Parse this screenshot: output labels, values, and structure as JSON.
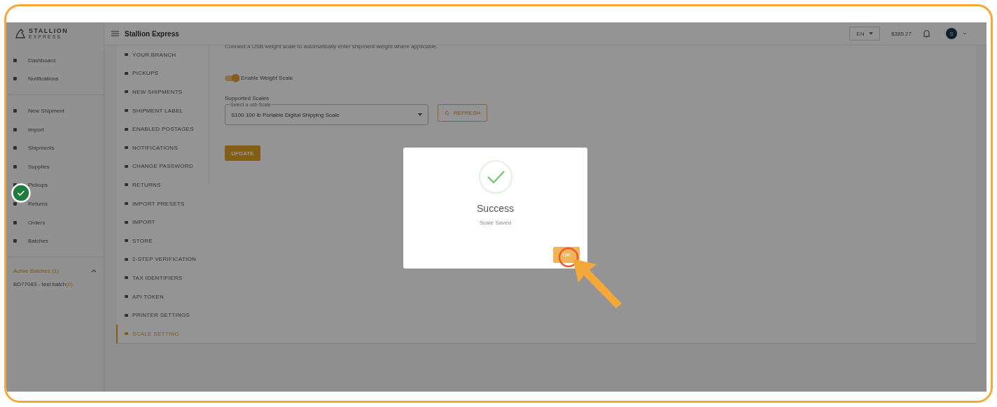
{
  "sidebar": {
    "logo": {
      "name": "STALLION",
      "sub": "EXPRESS"
    },
    "groups": [
      [
        {
          "label": "Dashboard"
        },
        {
          "label": "Notifications"
        }
      ],
      [
        {
          "label": "New Shipment"
        },
        {
          "label": "Import"
        },
        {
          "label": "Shipments"
        },
        {
          "label": "Supplies"
        },
        {
          "label": "Pickups"
        },
        {
          "label": "Returns"
        },
        {
          "label": "Orders"
        },
        {
          "label": "Batches"
        }
      ]
    ],
    "active_batches": {
      "title": "Active Batches (1)",
      "expanded": true,
      "items": [
        {
          "label": "BD77083 - test batch",
          "count": "(0)"
        }
      ]
    }
  },
  "topbar": {
    "title": "Stallion Express",
    "language": "EN",
    "balance": "$385.27",
    "avatar": "S"
  },
  "settings_menu": [
    {
      "label": "YOUR BRANCH",
      "selected": false
    },
    {
      "label": "PICKUPS",
      "selected": false
    },
    {
      "label": "NEW SHIPMENTS",
      "selected": false
    },
    {
      "label": "SHIPMENT LABEL",
      "selected": false
    },
    {
      "label": "ENABLED POSTAGES",
      "selected": false
    },
    {
      "label": "NOTIFICATIONS",
      "selected": false
    },
    {
      "label": "CHANGE PASSWORD",
      "selected": false
    },
    {
      "label": "RETURNS",
      "selected": false
    },
    {
      "label": "IMPORT PRESETS",
      "selected": false
    },
    {
      "label": "IMPORT",
      "selected": false
    },
    {
      "label": "STORE",
      "selected": false
    },
    {
      "label": "2-STEP VERIFICATION",
      "selected": false
    },
    {
      "label": "TAX IDENTIFIERS",
      "selected": false
    },
    {
      "label": "API TOKEN",
      "selected": false
    },
    {
      "label": "PRINTER SETTINGS",
      "selected": false
    },
    {
      "label": "SCALE SETTING",
      "selected": true
    }
  ],
  "scale_settings": {
    "description": "Connect a USB weight scale to automatically enter shipment weight where applicable.",
    "toggle": {
      "label": "Enable Weight Scale",
      "on": true
    },
    "scales_label": "Supported Scales",
    "select": {
      "floating_label": "Select a usb Scale",
      "value": "S100 100 lb Portable Digital Shipping Scale"
    },
    "refresh_button": "REFRESH",
    "update_button": "UPDATE"
  },
  "modal": {
    "title": "Success",
    "message": "Scale Saved",
    "button": "OK"
  }
}
